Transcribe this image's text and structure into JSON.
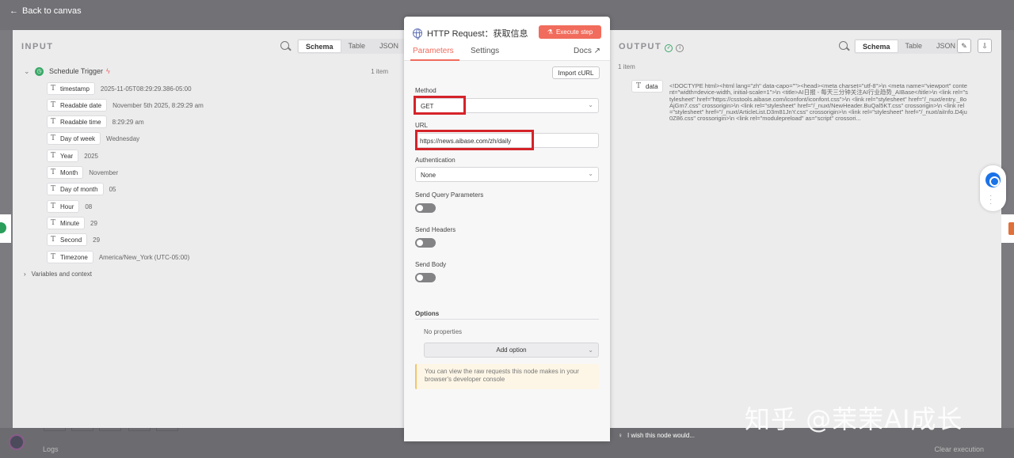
{
  "topbar": {
    "back_label": "Back to canvas"
  },
  "input": {
    "title": "INPUT",
    "view_tabs": [
      "Schema",
      "Table",
      "JSON"
    ],
    "trigger_name": "Schedule Trigger",
    "items_count": "1 item",
    "fields": [
      {
        "key": "timestamp",
        "value": "2025-11-05T08:29:29.386-05:00"
      },
      {
        "key": "Readable date",
        "value": "November 5th 2025, 8:29:29 am"
      },
      {
        "key": "Readable time",
        "value": "8:29:29 am"
      },
      {
        "key": "Day of week",
        "value": "Wednesday"
      },
      {
        "key": "Year",
        "value": "2025"
      },
      {
        "key": "Month",
        "value": "November"
      },
      {
        "key": "Day of month",
        "value": "05"
      },
      {
        "key": "Hour",
        "value": "08"
      },
      {
        "key": "Minute",
        "value": "29"
      },
      {
        "key": "Second",
        "value": "29"
      },
      {
        "key": "Timezone",
        "value": "America/New_York (UTC-05:00)"
      }
    ],
    "variables_label": "Variables and context"
  },
  "node": {
    "title": "HTTP Request：获取信息",
    "execute_label": "Execute step",
    "tabs": {
      "parameters": "Parameters",
      "settings": "Settings",
      "docs": "Docs"
    },
    "import_curl": "Import cURL",
    "method_label": "Method",
    "method_value": "GET",
    "url_label": "URL",
    "url_value": "https://news.aibase.com/zh/daily",
    "auth_label": "Authentication",
    "auth_value": "None",
    "send_query_label": "Send Query Parameters",
    "send_query_on": false,
    "send_headers_label": "Send Headers",
    "send_headers_on": false,
    "send_body_label": "Send Body",
    "send_body_on": false,
    "options_label": "Options",
    "no_properties": "No properties",
    "add_option": "Add option",
    "info_text": "You can view the raw requests this node makes in your browser's developer console"
  },
  "output": {
    "title": "OUTPUT",
    "view_tabs": [
      "Schema",
      "Table",
      "JSON"
    ],
    "items_count": "1 item",
    "data_key": "data",
    "data_value": "<!DOCTYPE html><html lang=\"zh\" data-capo=\"\"><head><meta charset=\"utf-8\">\\n <meta name=\"viewport\" content=\"width=device-width, initial-scale=1\">\\n <title>AI日报 - 每天三分钟关注AI行业趋势_AIBase</title>\\n <link rel=\"stylesheet\" href=\"https://csstools.aibase.com/iconfont/iconfont.css\">\\n <link rel=\"stylesheet\" href=\"/_nuxt/entry._8oAjGm7.css\" crossorigin>\\n <link rel=\"stylesheet\" href=\"/_nuxt/NewHeader.BuQal5KT.css\" crossorigin>\\n <link rel=\"stylesheet\" href=\"/_nuxt/ArticleList.D3m81JnY.css\" crossorigin>\\n <link rel=\"stylesheet\" href=\"/_nuxt/aiInfo.D4ju0Z86.css\" crossorigin>\\n <link rel=\"modulepreload\" as=\"script\" crossori..."
  },
  "footer": {
    "wish_text": "I wish this node would...",
    "logs_label": "Logs",
    "clear_execution": "Clear execution"
  },
  "watermark": "知乎 @茉茉AI成长"
}
